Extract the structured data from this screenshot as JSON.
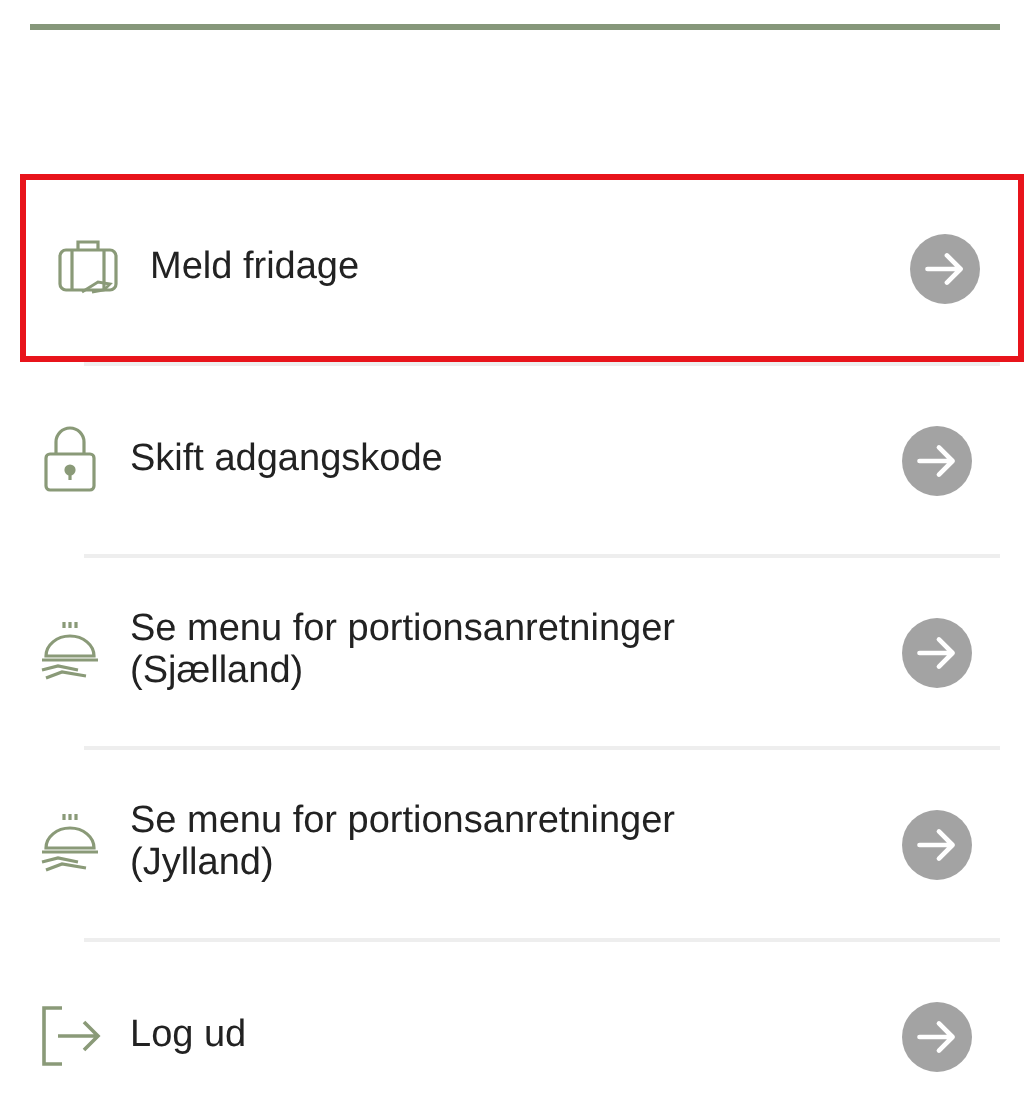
{
  "menu": [
    {
      "kind": "vacation",
      "label": "Meld fridage",
      "highlighted": true
    },
    {
      "kind": "lock",
      "label": "Skift adgangskode",
      "highlighted": false
    },
    {
      "kind": "cloche",
      "label": "Se menu for portionsanretninger (Sjælland)",
      "highlighted": false
    },
    {
      "kind": "cloche",
      "label": "Se menu for portionsanretninger (Jylland)",
      "highlighted": false
    },
    {
      "kind": "logout",
      "label": "Log ud",
      "highlighted": false
    }
  ]
}
